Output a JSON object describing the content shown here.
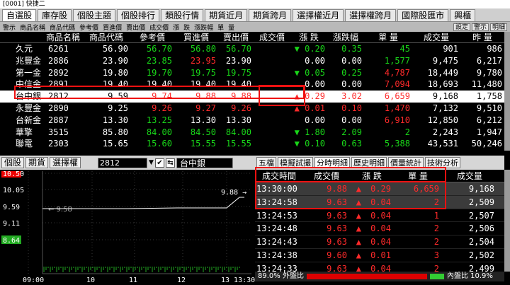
{
  "window": {
    "title": "[0001] 快捷二"
  },
  "tabs": [
    "自選股",
    "庫存股",
    "個股主題",
    "個股排行",
    "類股行情",
    "期貨近月",
    "期貨跨月",
    "選擇權近月",
    "選擇權跨月",
    "國際股匯市",
    "興櫃"
  ],
  "subbar": {
    "left": [
      "警示",
      "商品名稱",
      "商品代碼",
      "參考價",
      "買進價",
      "賣出價",
      "成交價",
      "漲",
      "跌",
      "漲跌幅",
      "單",
      "量"
    ],
    "right": [
      "設定",
      "警示",
      "明細"
    ]
  },
  "columns": [
    "警示",
    "商品名稱",
    "商品代碼",
    "參考價",
    "買進價",
    "賣出價",
    "成交價",
    "漲",
    "跌",
    "漲跌幅",
    "單量",
    "成交量",
    "昨量"
  ],
  "header_cols": [
    "",
    "商品名稱",
    "商品代碼",
    "參考價",
    "買進價",
    "賣出價",
    "成交價",
    "漲 跌",
    "漲跌幅",
    "單 量",
    "成交量",
    "昨 量"
  ],
  "rows": [
    {
      "name": "久元",
      "code": "6261",
      "ref": "56.90",
      "bid": "56.70",
      "ask": "56.80",
      "last": "56.70",
      "dir": "down",
      "chg": "0.20",
      "pct": "0.35",
      "vol": "45",
      "total": "901",
      "yvol": "986",
      "bidc": "g",
      "askc": "g",
      "lastc": "g",
      "chgc": "g",
      "pctc": "g",
      "volc": "g"
    },
    {
      "name": "兆豐金",
      "code": "2886",
      "ref": "23.90",
      "bid": "23.85",
      "ask": "23.95",
      "last": "23.90",
      "dir": "",
      "chg": "0.00",
      "pct": "0.00",
      "vol": "1,577",
      "total": "9,475",
      "yvol": "6,217",
      "bidc": "g",
      "askc": "r",
      "lastc": "w",
      "chgc": "w",
      "pctc": "w",
      "volc": "g"
    },
    {
      "name": "第一金",
      "code": "2892",
      "ref": "19.80",
      "bid": "19.70",
      "ask": "19.75",
      "last": "19.75",
      "dir": "down",
      "chg": "0.05",
      "pct": "0.25",
      "vol": "4,787",
      "total": "18,449",
      "yvol": "9,780",
      "bidc": "g",
      "askc": "g",
      "lastc": "g",
      "chgc": "g",
      "pctc": "g",
      "volc": "r"
    },
    {
      "name": "中信金",
      "code": "2891",
      "ref": "19.40",
      "bid": "19.40",
      "ask": "19.40",
      "last": "19.40",
      "dir": "",
      "chg": "0.00",
      "pct": "0.00",
      "vol": "7,094",
      "total": "18,693",
      "yvol": "11,480",
      "bidc": "w",
      "askc": "w",
      "lastc": "w",
      "chgc": "w",
      "pctc": "w",
      "volc": "r"
    },
    {
      "name": "台中銀",
      "code": "2812",
      "ref": "9.59",
      "bid": "9.74",
      "ask": "9.88",
      "last": "9.88",
      "dir": "up",
      "chg": "0.29",
      "pct": "3.02",
      "vol": "6,659",
      "total": "9,168",
      "yvol": "1,758",
      "bidc": "r",
      "askc": "r",
      "lastc": "r",
      "chgc": "r",
      "pctc": "r",
      "volc": "r",
      "sel": true
    },
    {
      "name": "永豐金",
      "code": "2890",
      "ref": "9.25",
      "bid": "9.26",
      "ask": "9.27",
      "last": "9.26",
      "dir": "up",
      "chg": "0.01",
      "pct": "0.10",
      "vol": "1,470",
      "total": "7,132",
      "yvol": "9,510",
      "bidc": "r",
      "askc": "r",
      "lastc": "r",
      "chgc": "r",
      "pctc": "r",
      "volc": "r"
    },
    {
      "name": "台新金",
      "code": "2887",
      "ref": "13.30",
      "bid": "13.25",
      "ask": "13.30",
      "last": "13.30",
      "dir": "",
      "chg": "0.00",
      "pct": "0.00",
      "vol": "6,910",
      "total": "12,850",
      "yvol": "6,212",
      "bidc": "g",
      "askc": "w",
      "lastc": "w",
      "chgc": "w",
      "pctc": "w",
      "volc": "r"
    },
    {
      "name": "華擎",
      "code": "3515",
      "ref": "85.80",
      "bid": "84.00",
      "ask": "84.50",
      "last": "84.00",
      "dir": "down",
      "chg": "1.80",
      "pct": "2.09",
      "vol": "2",
      "total": "2,243",
      "yvol": "1,947",
      "bidc": "g",
      "askc": "g",
      "lastc": "g",
      "chgc": "g",
      "pctc": "g",
      "volc": "g"
    },
    {
      "name": "聯電",
      "code": "2303",
      "ref": "15.65",
      "bid": "15.60",
      "ask": "15.55",
      "last": "15.55",
      "dir": "down",
      "chg": "0.10",
      "pct": "0.63",
      "vol": "5,388",
      "total": "43,531",
      "yvol": "50,246",
      "bidc": "g",
      "askc": "g",
      "lastc": "g",
      "chgc": "g",
      "pctc": "g",
      "volc": "g"
    },
    {
      "name": "遠東銀",
      "code": "2845",
      "ref": "9.49",
      "bid": "9.25",
      "ask": "9.38",
      "last": "9.25",
      "dir": "down",
      "chg": "0.15",
      "pct": "1.58",
      "vol": "61",
      "total": "1,079",
      "yvol": "2,000",
      "bidc": "g",
      "askc": "g",
      "lastc": "g",
      "chgc": "g",
      "pctc": "g",
      "volc": "g"
    }
  ],
  "bottom_left": {
    "tabs": [
      "個股",
      "期貨",
      "選擇權"
    ],
    "symbol": "2812",
    "stock_name": "台中銀",
    "price_labels": [
      "10.50",
      "10.05",
      "9.59",
      "9.11",
      "8.64"
    ],
    "time_labels": [
      "09:00",
      "10",
      "11",
      "12",
      "13 13:30"
    ],
    "last_label": "9.88",
    "ref_label": "9.58"
  },
  "bottom_right": {
    "tabs": [
      "五檔",
      "模擬試撮",
      "分時明細",
      "歷史明細",
      "價量統計",
      "技術分析"
    ],
    "active_tab": "分時明細",
    "header": [
      "成交時間",
      "成交價",
      "漲 跌",
      "單 量",
      "成交量"
    ],
    "rows": [
      {
        "time": "13:30:00",
        "price": "9.88",
        "dir": "up",
        "chg": "0.29",
        "vol": "6,659",
        "total": "9,168",
        "hi": true
      },
      {
        "time": "13:24:58",
        "price": "9.63",
        "dir": "up",
        "chg": "0.04",
        "vol": "2",
        "total": "2,509",
        "hi": true
      },
      {
        "time": "13:24:53",
        "price": "9.63",
        "dir": "up",
        "chg": "0.04",
        "vol": "1",
        "total": "2,507",
        "hi": false
      },
      {
        "time": "13:24:48",
        "price": "9.63",
        "dir": "up",
        "chg": "0.04",
        "vol": "2",
        "total": "2,506",
        "hi": false
      },
      {
        "time": "13:24:43",
        "price": "9.63",
        "dir": "up",
        "chg": "0.04",
        "vol": "2",
        "total": "2,504",
        "hi": false
      },
      {
        "time": "13:24:38",
        "price": "9.60",
        "dir": "up",
        "chg": "0.01",
        "vol": "3",
        "total": "2,502",
        "hi": false
      },
      {
        "time": "13:24:33",
        "price": "9.63",
        "dir": "up",
        "chg": "0.04",
        "vol": "2",
        "total": "2,499",
        "hi": false
      }
    ],
    "status_left": "89.0% 外盤比",
    "status_right": "內盤比 10.9%",
    "outer_ratio": 89.0
  },
  "colors": {
    "up": "#ff2a2a",
    "down": "#19d719",
    "flat": "#ffffff",
    "highlight": "#e11111"
  }
}
